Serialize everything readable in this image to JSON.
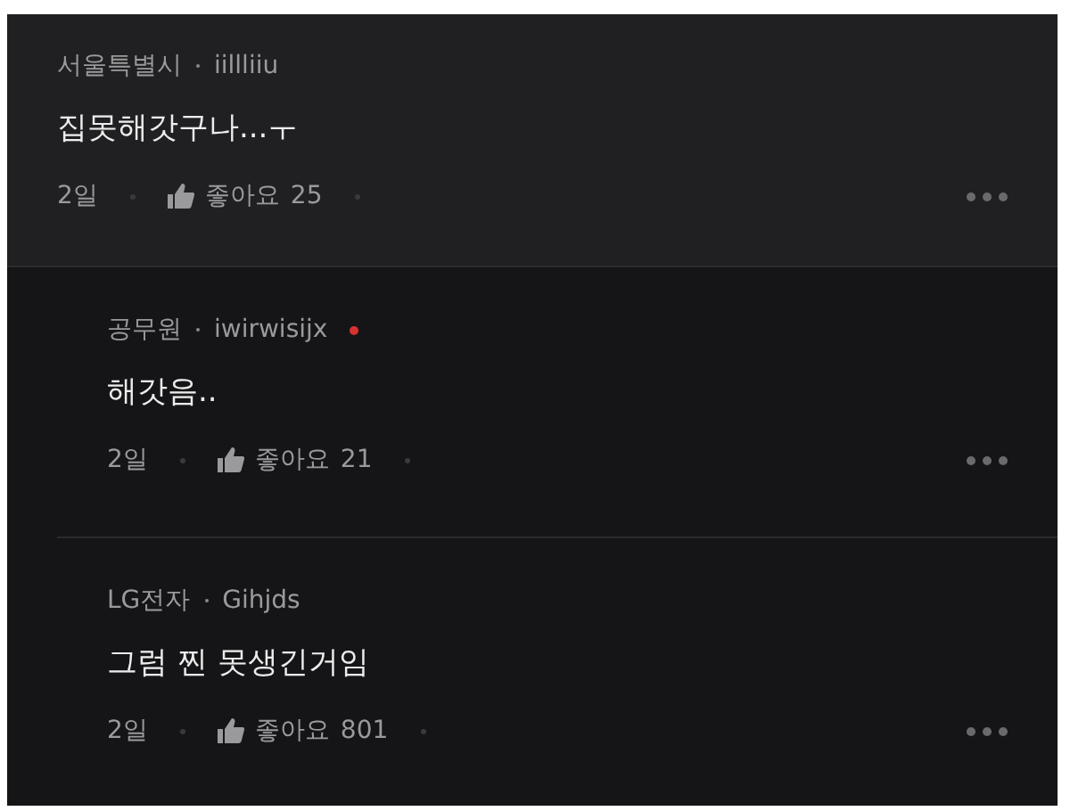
{
  "comments": [
    {
      "kind": "comment",
      "affiliation": "서울특별시",
      "author": "iillliiu",
      "marked": false,
      "text": "집못해갓구나...ㅜ",
      "age": "2일",
      "likes_label": "좋아요",
      "likes": "25"
    },
    {
      "kind": "reply",
      "affiliation": "공무원",
      "author": "iwirwisijx",
      "marked": true,
      "text": "해갓음..",
      "age": "2일",
      "likes_label": "좋아요",
      "likes": "21"
    },
    {
      "kind": "reply",
      "affiliation": "LG전자",
      "author": "Gihjds",
      "marked": false,
      "text": "그럼 찐 못생긴거임",
      "age": "2일",
      "likes_label": "좋아요",
      "likes": "801"
    }
  ]
}
